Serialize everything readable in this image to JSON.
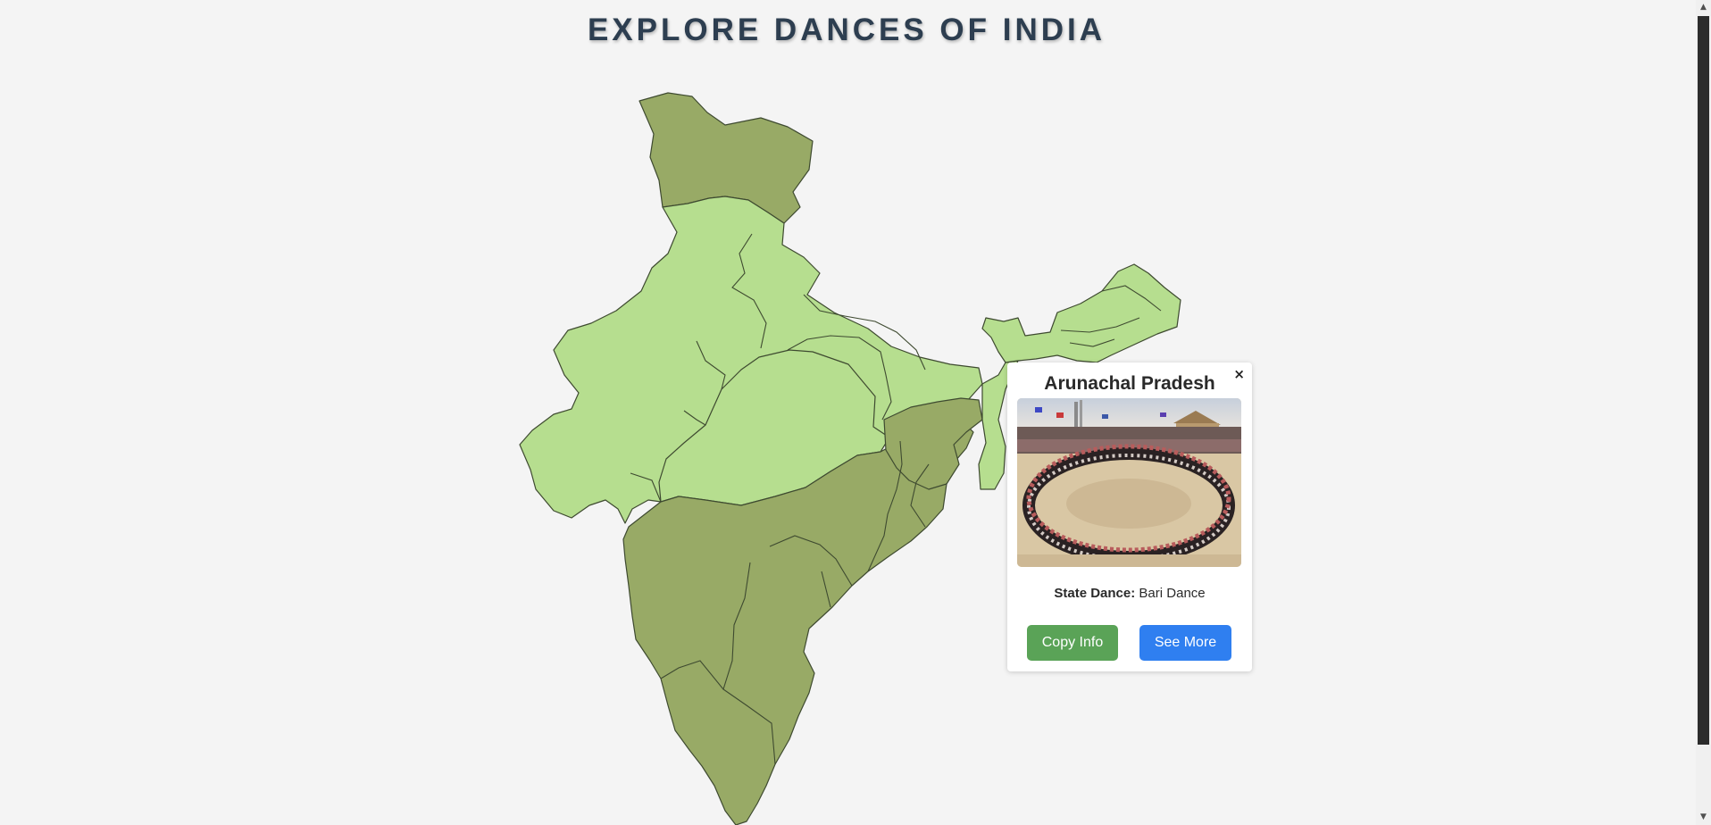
{
  "page": {
    "title": "EXPLORE DANCES OF INDIA"
  },
  "map": {
    "regions": [
      {
        "name": "jammu-kashmir",
        "group": "south"
      },
      {
        "name": "northern-states",
        "group": "north"
      },
      {
        "name": "madhya-pradesh",
        "group": "north"
      },
      {
        "name": "central-south",
        "group": "south"
      },
      {
        "name": "jharkhand",
        "group": "south"
      },
      {
        "name": "west-bengal",
        "group": "north"
      },
      {
        "name": "northeast",
        "group": "north"
      }
    ],
    "colors": {
      "north": "#b6de8f",
      "south": "#98aa66",
      "border": "#3e4a30"
    }
  },
  "popup": {
    "close_label": "×",
    "title": "Arunachal Pradesh",
    "image_icon": "dance-photo",
    "dance_label": "State Dance:",
    "dance_value": "Bari Dance",
    "copy_button": "Copy Info",
    "more_button": "See More"
  },
  "colors": {
    "background": "#f4f4f4",
    "title": "#2d3e50",
    "copy_btn": "#5aa357",
    "more_btn": "#2f7ff0"
  }
}
